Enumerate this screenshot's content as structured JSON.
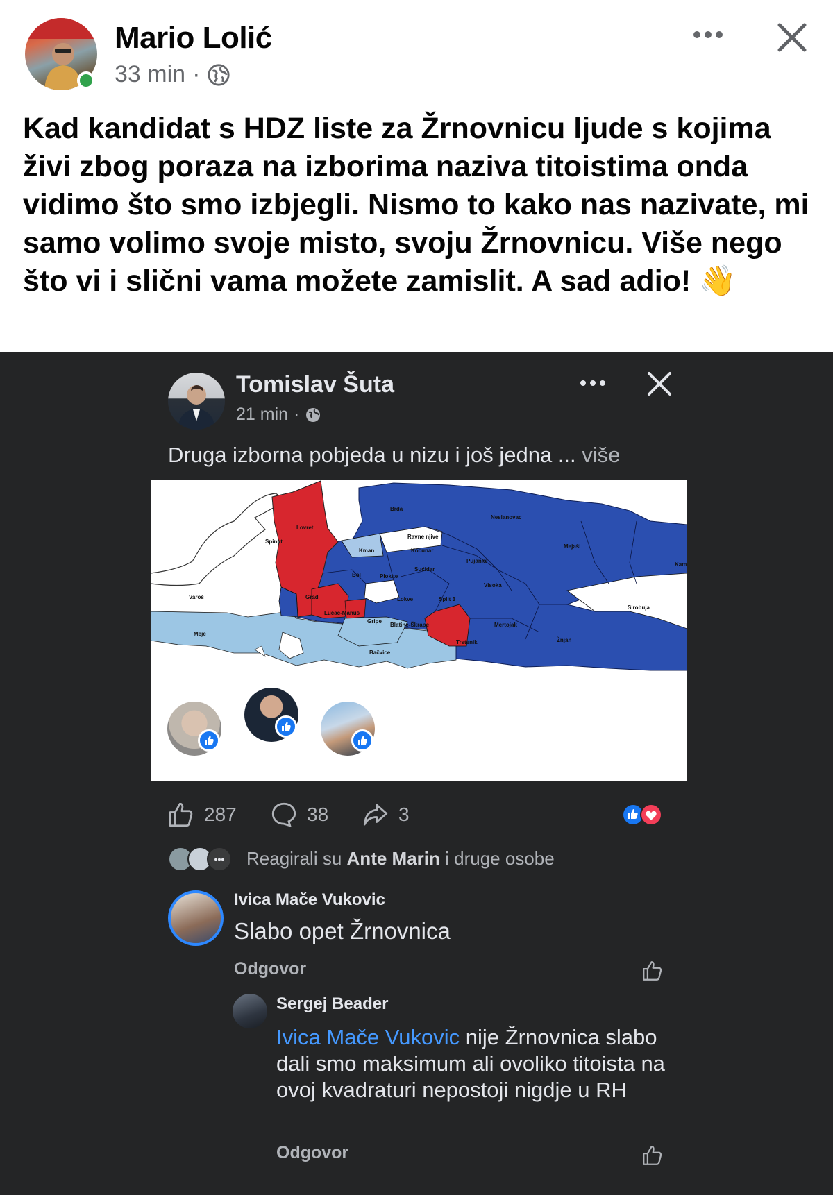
{
  "outer_post": {
    "author": "Mario Lolić",
    "time": "33 min",
    "separator": "·",
    "privacy_icon": "globe-icon",
    "text": "Kad kandidat s HDZ liste za Žrnovnicu  ljude s kojima živi zbog poraza na izborima naziva titoistima onda vidimo što smo izbjegli. Nismo to kako nas nazivate, mi samo volimo svoje misto, svoju Žrnovnicu. Više nego što vi i slični vama možete zamislit.  A sad adio!",
    "emoji": "👋"
  },
  "shared_post": {
    "author": "Tomislav Šuta",
    "time": "21 min",
    "separator": "·",
    "text": "Druga izborna pobjeda u nizu i još jedna ...",
    "more": "više",
    "map_labels": {
      "brda": "Brda",
      "neslanovac": "Neslanovac",
      "lovret": "Lovret",
      "spinut": "Spinut",
      "ravne_njive": "Ravne njive",
      "kman": "Kman",
      "kocunar": "Kocunar",
      "pujanke": "Pujanke",
      "mejasi": "Mejaši",
      "kam": "Kam",
      "sucidar": "Sućidar",
      "bol": "Bol",
      "plokite": "Plokite",
      "visoka": "Visoka",
      "varos": "Varoš",
      "grad": "Grad",
      "lokve": "Lokve",
      "split3": "Split 3",
      "sirobuja": "Sirobuja",
      "lucac_manus": "Lučac-Manuš",
      "gripe": "Gripe",
      "blatine_skrape": "Blatine-Škrape",
      "mertojak": "Mertojak",
      "meje": "Meje",
      "trstenik": "Trstenik",
      "znjan": "Žnjan",
      "bacvice": "Bačvice"
    },
    "counts": {
      "likes": "287",
      "comments": "38",
      "shares": "3"
    },
    "reacted_prefix": "Reagirali su",
    "reacted_name": "Ante Marin",
    "reacted_suffix": "i druge osobe",
    "comments": [
      {
        "author": "Ivica Mače Vukovic",
        "text": "Slabo opet Žrnovnica",
        "reply": "Odgovor"
      },
      {
        "author": "Sergej Beader",
        "mention": "Ivica Mače Vukovic",
        "text": " nije Žrnovnica slabo dali smo maksimum ali ovoliko titoista na ovoj kvadraturi nepostoji nigdje u RH",
        "reply": "Odgovor"
      }
    ]
  },
  "colors": {
    "facebook_blue": "#1877f2",
    "map_blue": "#2b4fb0",
    "map_red": "#d7262e",
    "map_light_blue": "#9cc6e4",
    "dark_bg": "#242526",
    "online_green": "#31a24c"
  }
}
